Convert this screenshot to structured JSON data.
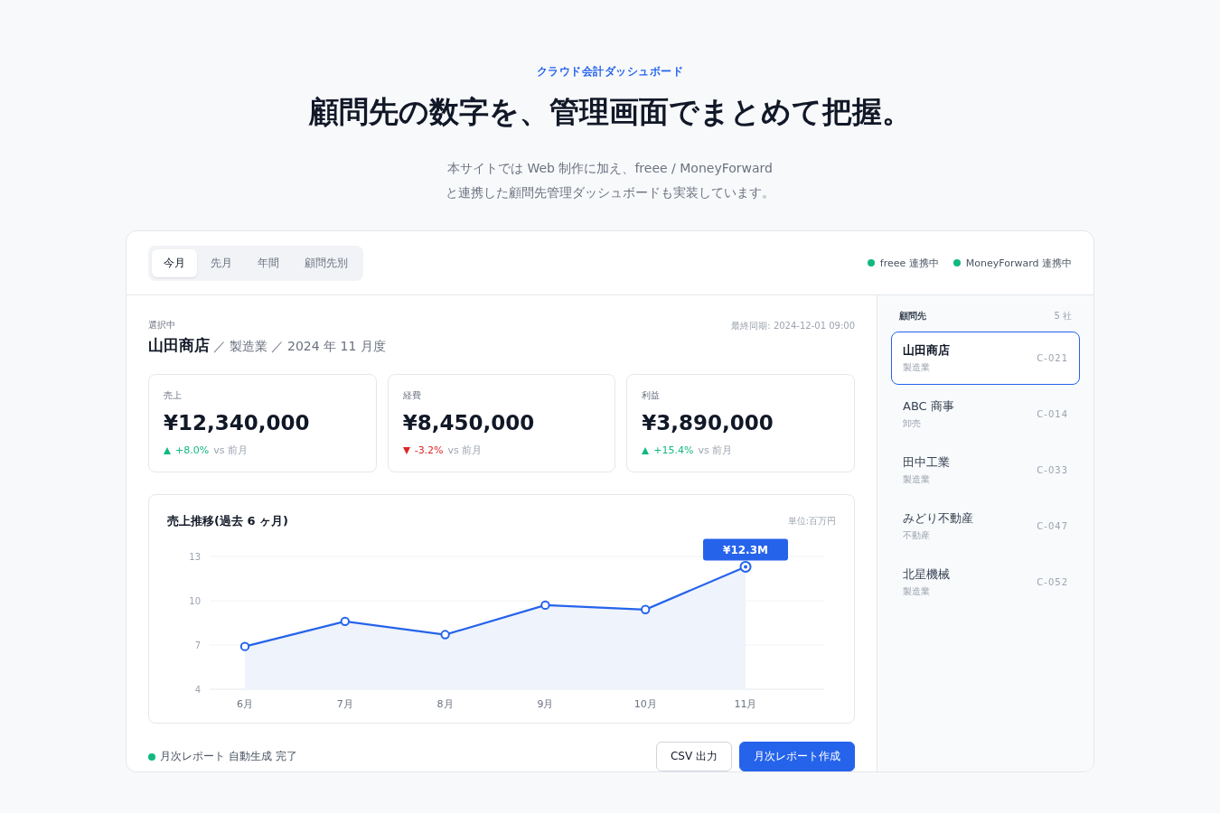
{
  "hero": {
    "eyebrow": "クラウド会計ダッシュボード",
    "title": "顧問先の数字を、管理画面でまとめて把握。",
    "lead_lines": [
      "本サイトでは Web 制作に加え、freee / MoneyForward",
      "と連携した顧問先管理ダッシュボードも実装しています。"
    ]
  },
  "dashboard": {
    "tabs": [
      {
        "label": "今月",
        "selected": true
      },
      {
        "label": "先月",
        "selected": false
      },
      {
        "label": "年間",
        "selected": false
      },
      {
        "label": "顧問先別",
        "selected": false
      }
    ],
    "integrations": [
      {
        "label": "freee 連携中",
        "color": "#10b981"
      },
      {
        "label": "MoneyForward 連携中",
        "color": "#10b981"
      }
    ],
    "selected_label": "選択中",
    "client_name": "山田商店",
    "client_meta_separator": "／",
    "client_meta": [
      "製造業",
      "2024 年 11 月度"
    ],
    "last_sync": "最終同期: 2024-12-01 09:00",
    "kpis": [
      {
        "label": "売上",
        "value": "¥12,340,000",
        "kind": "up",
        "delta": "+8.0%",
        "compare": "vs 前月"
      },
      {
        "label": "経費",
        "value": "¥8,450,000",
        "kind": "down",
        "delta": "-3.2%",
        "compare": "vs 前月"
      },
      {
        "label": "利益",
        "value": "¥3,890,000",
        "kind": "up",
        "delta": "+15.4%",
        "compare": "vs 前月"
      }
    ],
    "chart": {
      "title": "売上推移(過去 6 ヶ月)",
      "unit": "単位:百万円",
      "chart_data": {
        "type": "area",
        "categories": [
          "6月",
          "7月",
          "8月",
          "9月",
          "10月",
          "11月"
        ],
        "series": [
          {
            "color": "#2563eb",
            "values": [
              6.9,
              8.6,
              7.7,
              9.7,
              9.4,
              12.3
            ]
          }
        ],
        "ylim": [
          4,
          13
        ],
        "yticks": [
          4,
          7,
          10,
          13
        ],
        "annotations": [
          "¥12.3M"
        ]
      }
    },
    "status": {
      "label": "月次レポート 自動生成 完了",
      "color": "#10b981"
    },
    "buttons": [
      {
        "label": "CSV 出力",
        "kind": "secondary"
      },
      {
        "label": "月次レポート作成",
        "kind": "primary"
      }
    ],
    "sidebar": {
      "title": "顧問先",
      "count": "5 社",
      "items": [
        {
          "name": "山田商店",
          "industry": "製造業",
          "code": "C-021",
          "selected": true
        },
        {
          "name": "ABC 商事",
          "industry": "卸売",
          "code": "C-014",
          "selected": false
        },
        {
          "name": "田中工業",
          "industry": "製造業",
          "code": "C-033",
          "selected": false
        },
        {
          "name": "みどり不動産",
          "industry": "不動産",
          "code": "C-047",
          "selected": false
        },
        {
          "name": "北星機械",
          "industry": "製造業",
          "code": "C-052",
          "selected": false
        }
      ]
    }
  }
}
